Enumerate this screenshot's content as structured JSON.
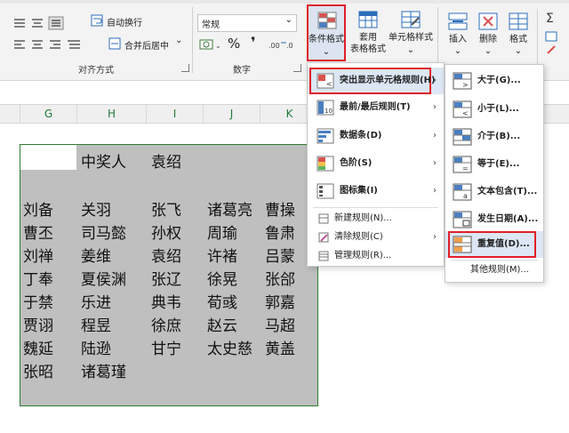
{
  "ribbon": {
    "wrap_text": "自动换行",
    "merge_center": "合并后居中",
    "merge_dropdown": "⌄",
    "alignment_group": "对齐方式",
    "number_group": "数字",
    "number_format": "常规",
    "percent_symbol": "%",
    "comma_symbol": "❜",
    "conditional_format": "条件格式",
    "table_format_line1": "套用",
    "table_format_line2": "表格格式",
    "cell_style": "单元格样式",
    "insert": "插入",
    "delete": "删除",
    "format": "格式",
    "dropdown_caret": "⌄"
  },
  "columns": [
    "G",
    "H",
    "I",
    "J",
    "K"
  ],
  "sheet": {
    "header_row": [
      "",
      "中奖人",
      "袁绍"
    ],
    "names": [
      [
        "刘备",
        "关羽",
        "张飞",
        "诸葛亮",
        "曹操"
      ],
      [
        "曹丕",
        "司马懿",
        "孙权",
        "周瑜",
        "鲁肃"
      ],
      [
        "刘禅",
        "姜维",
        "袁绍",
        "许褚",
        "吕蒙"
      ],
      [
        "丁奉",
        "夏侯渊",
        "张辽",
        "徐晃",
        "张郃"
      ],
      [
        "于禁",
        "乐进",
        "典韦",
        "荀彧",
        "郭嘉"
      ],
      [
        "贾诩",
        "程昱",
        "徐庶",
        "赵云",
        "马超"
      ],
      [
        "魏延",
        "陆逊",
        "甘宁",
        "太史慈",
        "黄盖"
      ],
      [
        "张昭",
        "诸葛瑾",
        "",
        "",
        ""
      ]
    ]
  },
  "cf_menu": {
    "items": [
      {
        "label": "突出显示单元格规则(H)",
        "icon": "highlight-rules-icon"
      },
      {
        "label": "最前/最后规则(T)",
        "icon": "top-bottom-rules-icon"
      },
      {
        "label": "数据条(D)",
        "icon": "data-bars-icon"
      },
      {
        "label": "色阶(S)",
        "icon": "color-scales-icon"
      },
      {
        "label": "图标集(I)",
        "icon": "icon-sets-icon"
      }
    ],
    "small_items": [
      {
        "label": "新建规则(N)...",
        "icon": "new-rule-icon"
      },
      {
        "label": "清除规则(C)",
        "icon": "clear-rules-icon"
      },
      {
        "label": "管理规则(R)...",
        "icon": "manage-rules-icon"
      }
    ],
    "arrow": "›"
  },
  "sub_menu": {
    "items": [
      {
        "label": "大于(G)...",
        "icon": "greater-than-icon"
      },
      {
        "label": "小于(L)...",
        "icon": "less-than-icon"
      },
      {
        "label": "介于(B)...",
        "icon": "between-icon"
      },
      {
        "label": "等于(E)...",
        "icon": "equal-to-icon"
      },
      {
        "label": "文本包含(T)...",
        "icon": "text-contains-icon"
      },
      {
        "label": "发生日期(A)...",
        "icon": "date-occurring-icon"
      },
      {
        "label": "重复值(D)...",
        "icon": "duplicate-values-icon"
      }
    ],
    "more_rules": "其他规则(M)..."
  },
  "colors": {
    "accent_red": "#e0202a",
    "excel_green": "#2e7d32",
    "selection_gray": "#bfbfbf",
    "menu_highlight": "#dce6f4"
  }
}
